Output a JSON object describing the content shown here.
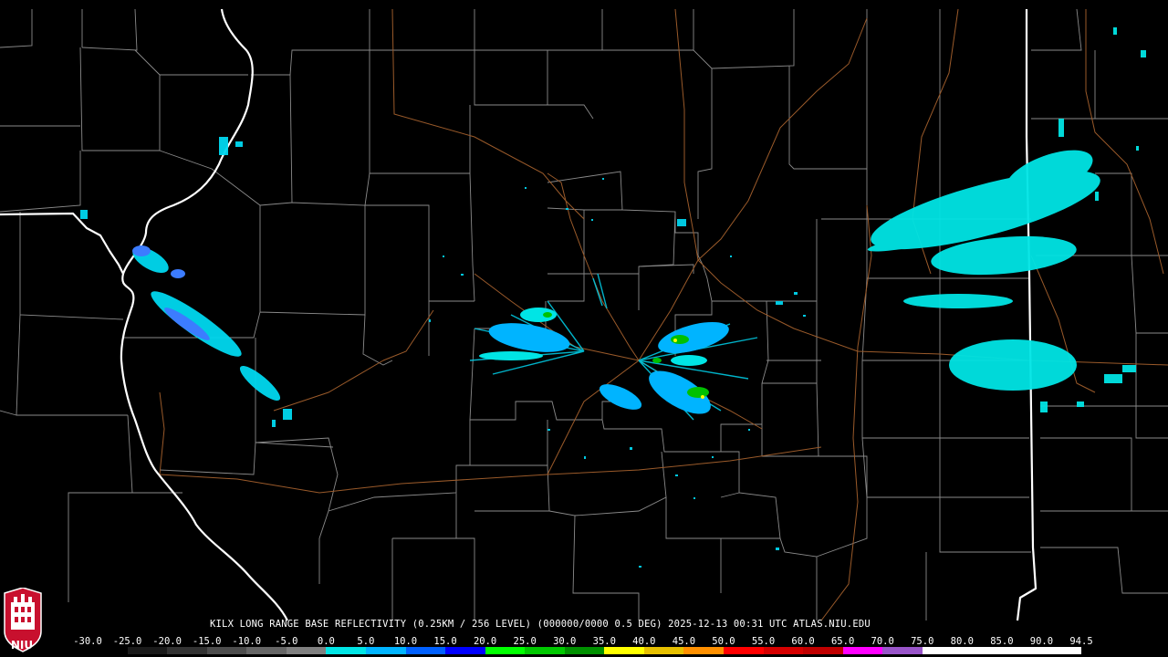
{
  "title": "KILX LONG RANGE BASE REFLECTIVITY (0.25KM / 256 LEVEL) (000000/0000 0.5 DEG) 2025-12-13 00:31 UTC  ATLAS.NIU.EDU",
  "logo": {
    "text": "NIU",
    "icon": "niu-seal-icon"
  },
  "legend": {
    "ticks": [
      "-30.0",
      "-25.0",
      "-20.0",
      "-15.0",
      "-10.0",
      "-5.0",
      "0.0",
      "5.0",
      "10.0",
      "15.0",
      "20.0",
      "25.0",
      "30.0",
      "35.0",
      "40.0",
      "45.0",
      "50.0",
      "55.0",
      "60.0",
      "65.0",
      "70.0",
      "75.0",
      "80.0",
      "85.0",
      "90.0",
      "94.5"
    ],
    "colors": [
      "#000000",
      "#1a1a1a",
      "#333333",
      "#4d4d4d",
      "#666666",
      "#808080",
      "#00e5e5",
      "#00b4ff",
      "#0060ff",
      "#0000ff",
      "#00ff00",
      "#00c800",
      "#009000",
      "#ffff00",
      "#e7c000",
      "#ff9000",
      "#ff0000",
      "#d60000",
      "#c00000",
      "#ff00ff",
      "#9955c9",
      "#ffffff",
      "#ffffff",
      "#ffffff",
      "#ffffff"
    ]
  },
  "colors": {
    "background": "#000000",
    "county_lines": "#8a8a8a",
    "state_lines": "#ffffff",
    "roads": "#9a5a2a",
    "echo_light": "#00e5e5",
    "echo_medium": "#00a0ff",
    "echo_strong": "#00c000"
  }
}
